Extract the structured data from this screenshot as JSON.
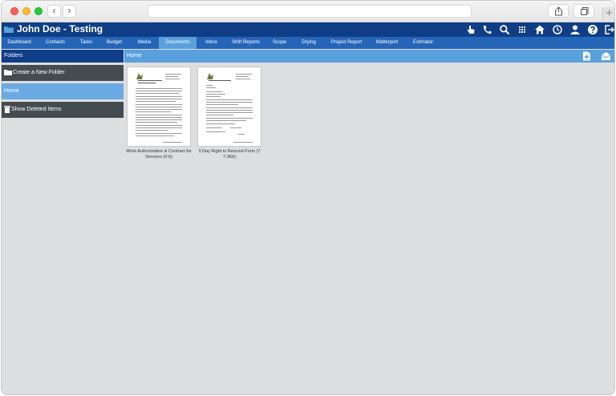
{
  "app": {
    "title": "John Doe - Testing",
    "colors": {
      "topbar": "#0f3e87",
      "tabbar": "#2565b8",
      "active_tab": "#5aa0dc",
      "sidebar_dark": "#454c50",
      "sidebar_selected": "#6aaae3",
      "content_bg": "#dcdedf"
    },
    "top_icons": [
      "hand-pointer-icon",
      "phone-icon",
      "search-icon",
      "grid-icon",
      "home-icon",
      "clock-icon",
      "user-icon",
      "help-icon",
      "logout-icon"
    ]
  },
  "tabs": [
    {
      "label": "Dashboard"
    },
    {
      "label": "Contacts"
    },
    {
      "label": "Tasks"
    },
    {
      "label": "Budget"
    },
    {
      "label": "Media"
    },
    {
      "label": "Documents",
      "active": true
    },
    {
      "label": "Inbox"
    },
    {
      "label": "Shift Reports"
    },
    {
      "label": "Scope"
    },
    {
      "label": "Drying"
    },
    {
      "label": "Project Report"
    },
    {
      "label": "Matterport"
    },
    {
      "label": "Estimator"
    }
  ],
  "sidebar": {
    "header": "Folders",
    "items": [
      {
        "label": "Create a New Folder",
        "icon": "new-folder-icon"
      },
      {
        "label": "Home",
        "selected": true
      },
      {
        "label": "Show Deleted Items",
        "icon": "trash-icon"
      }
    ]
  },
  "main": {
    "breadcrumb": "Home",
    "header_icons": [
      "add-document-icon",
      "email-icon"
    ],
    "documents": [
      {
        "caption": "Work Authorization & Contract for Services (0 b)"
      },
      {
        "caption": "3 Day Right to Rescind Form (7 7.3Kb)"
      }
    ]
  }
}
